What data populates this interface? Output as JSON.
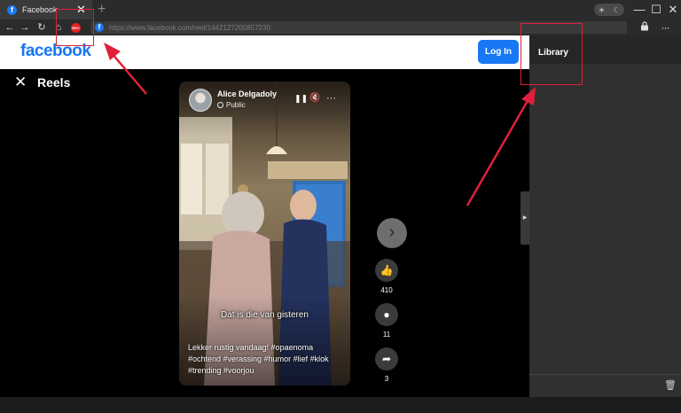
{
  "browser": {
    "tab": {
      "title": "Facebook",
      "close_glyph": "✕"
    },
    "new_tab_glyph": "+",
    "theme_toggle": {
      "sun": "☀",
      "moon": "☾"
    },
    "window": {
      "minimize": "—",
      "maximize": "☐",
      "close": "✕"
    },
    "nav": {
      "back": "←",
      "forward": "→",
      "reload": "↻",
      "home": "⌂"
    },
    "rec_label": "REC",
    "url": "https://www.facebook.com/reel/1442127200857230",
    "more": "···"
  },
  "facebook": {
    "logo": "facebook",
    "login_label": "Log In",
    "reels_close": "✕",
    "reels_title": "Reels",
    "reel": {
      "author": "Alice Delgadoly",
      "audience": "Public",
      "caption_overlay": "Dat is die van gisteren",
      "description": "Lekker rustig vandaag! #opaenoma #ochtend #verassing #humor #lief #klok #trending #voorjou",
      "controls": {
        "pause": "❚❚",
        "mute": "🔇",
        "more": "···"
      }
    },
    "actions": {
      "next": "›",
      "like": {
        "icon": "👍",
        "count": "410"
      },
      "comment": {
        "icon": "●",
        "count": "11"
      },
      "share": {
        "icon": "➦",
        "count": "3"
      }
    }
  },
  "panel": {
    "title": "Library",
    "collapse_glyph": "▶",
    "trash_glyph": "🗑"
  },
  "colors": {
    "facebook_blue": "#1877f2",
    "rec_red": "#e32222",
    "annotation_red": "#e0203a"
  }
}
